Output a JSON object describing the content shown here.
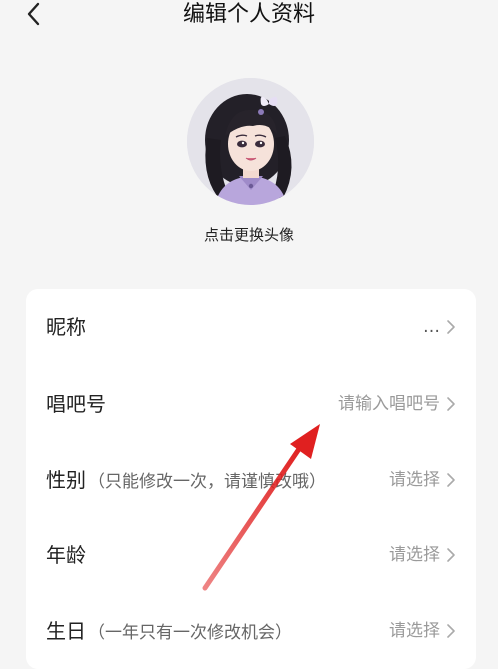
{
  "header": {
    "title": "编辑个人资料",
    "back_icon": "chevron-left-icon"
  },
  "avatar": {
    "caption": "点击更换头像"
  },
  "profile_rows": [
    {
      "label": "昵称",
      "hint": "",
      "value": "…"
    },
    {
      "label": "唱吧号",
      "hint": "",
      "value": "请输入唱吧号"
    },
    {
      "label": "性别",
      "hint": "（只能修改一次，请谨慎改哦）",
      "value": "请选择"
    },
    {
      "label": "年龄",
      "hint": "",
      "value": "请选择"
    },
    {
      "label": "生日",
      "hint": "（一年只有一次修改机会）",
      "value": "请选择"
    }
  ],
  "colors": {
    "page_background": "#f5f5f5",
    "card_background": "#ffffff",
    "annotation_arrow": "#e02020"
  }
}
